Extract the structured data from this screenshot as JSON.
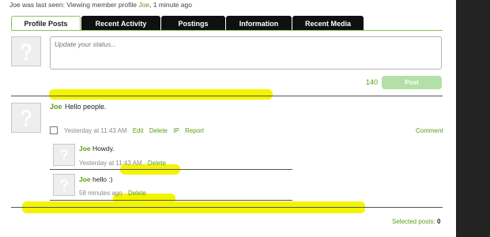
{
  "header": {
    "last_seen_prefix": "Joe was last seen:",
    "last_seen_activity": "Viewing member profile",
    "last_seen_user": "Joe",
    "last_seen_time": ", 1 minute ago"
  },
  "tabs": [
    {
      "label": "Profile Posts",
      "active": true
    },
    {
      "label": "Recent Activity",
      "active": false
    },
    {
      "label": "Postings",
      "active": false
    },
    {
      "label": "Information",
      "active": false
    },
    {
      "label": "Recent Media",
      "active": false
    }
  ],
  "status": {
    "placeholder": "Update your status...",
    "char_count": "140",
    "post_label": "Post"
  },
  "main_post": {
    "author": "Joe",
    "text": "Hello people.",
    "time": "Yesterday at 11:43 AM",
    "actions": [
      "Edit",
      "Delete",
      "IP",
      "Report"
    ],
    "comment_label": "Comment"
  },
  "comments": [
    {
      "author": "Joe",
      "text": "Howdy.",
      "time": "Yesterday at 11:43 AM",
      "delete_label": "Delete"
    },
    {
      "author": "Joe",
      "text": "hello :)",
      "time": "58 minutes ago",
      "delete_label": "Delete"
    }
  ],
  "footer": {
    "selected_label": "Selected posts:",
    "selected_count": "0"
  },
  "colors": {
    "accent_green": "#5a9e16",
    "highlight": "#f4f400",
    "tab_dark": "#101010",
    "post_button": "#b2e0a6"
  }
}
